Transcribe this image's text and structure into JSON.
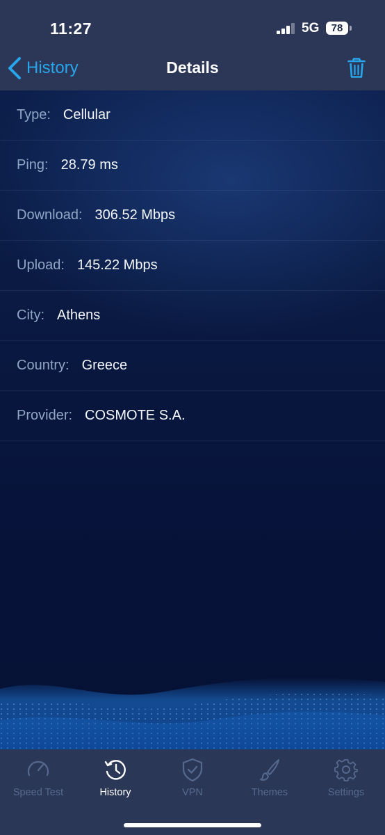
{
  "status": {
    "time": "11:27",
    "network": "5G",
    "battery": "78"
  },
  "nav": {
    "back_label": "History",
    "title": "Details"
  },
  "details": [
    {
      "label": "Type:",
      "value": "Cellular"
    },
    {
      "label": "Ping:",
      "value": "28.79 ms"
    },
    {
      "label": "Download:",
      "value": "306.52 Mbps"
    },
    {
      "label": "Upload:",
      "value": "145.22 Mbps"
    },
    {
      "label": "City:",
      "value": "Athens"
    },
    {
      "label": "Country:",
      "value": "Greece"
    },
    {
      "label": "Provider:",
      "value": "COSMOTE S.A."
    }
  ],
  "tabs": [
    {
      "label": "Speed Test",
      "icon": "speedometer-icon",
      "active": false
    },
    {
      "label": "History",
      "icon": "history-icon",
      "active": true
    },
    {
      "label": "VPN",
      "icon": "shield-check-icon",
      "active": false
    },
    {
      "label": "Themes",
      "icon": "brush-icon",
      "active": false
    },
    {
      "label": "Settings",
      "icon": "gear-icon",
      "active": false
    }
  ],
  "colors": {
    "accent": "#27a6ec",
    "header_bg": "#2c3656",
    "tab_inactive": "#55698e"
  }
}
